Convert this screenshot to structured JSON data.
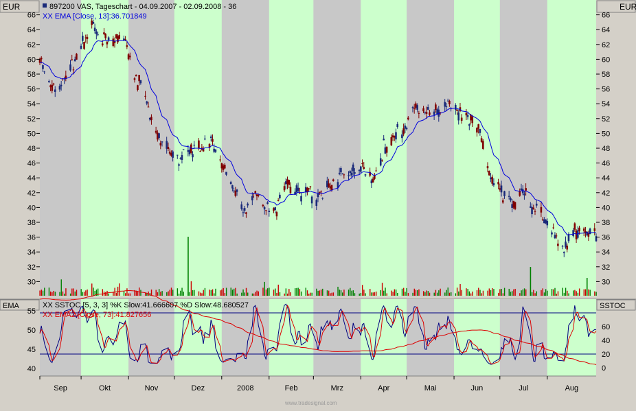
{
  "main_panel": {
    "left_unit": "EUR",
    "right_unit": "EUR",
    "legend_line1": "897200 VAS, Tageschart - 04.09.2007 - 02.09.2008 - 36",
    "legend_line2": "XX EMA [Close, 13]:36.701849"
  },
  "lower_panel": {
    "left_label": "EMA",
    "right_label": "SSTOC",
    "legend_line1": "XX SSTOC [5, 3, 3] %K Slow:41.666607 %D Slow:48.680527",
    "legend_line2": "XX EMA2 [Close, 73]:41.827656"
  },
  "footer": {
    "watermark": "www.tradesignal.com"
  },
  "colors": {
    "band_green": "#ccffcc",
    "band_gray": "#c8c8c8",
    "price_bar": "#800000",
    "price_bar_up": "#1a2a7a",
    "ema": "#0000dd",
    "volume_up": "#008000",
    "volume_down": "#cc0000",
    "k_line": "#000080",
    "d_line": "#dd0000",
    "ema2": "#dd0000",
    "stoc_levels": "#000080"
  },
  "chart_data": [
    {
      "type": "candlestick",
      "title": "897200 VAS, Tageschart - 04.09.2007 - 02.09.2008 - 36",
      "ylabel": "EUR",
      "ylim": [
        28,
        68
      ],
      "x_ticks": [
        "Sep",
        "Okt",
        "Nov",
        "Dez",
        "2008",
        "Feb",
        "Mrz",
        "Apr",
        "Mai",
        "Jun",
        "Jul",
        "Aug"
      ],
      "y_ticks": [
        30,
        32,
        34,
        36,
        38,
        40,
        42,
        44,
        46,
        48,
        50,
        52,
        54,
        56,
        58,
        60,
        62,
        64,
        66
      ],
      "close_series": [
        {
          "d": "2007-09-04",
          "c": 60
        },
        {
          "d": "2007-09-10",
          "c": 57
        },
        {
          "d": "2007-09-17",
          "c": 56
        },
        {
          "d": "2007-09-24",
          "c": 59
        },
        {
          "d": "2007-10-01",
          "c": 62
        },
        {
          "d": "2007-10-08",
          "c": 64
        },
        {
          "d": "2007-10-15",
          "c": 63
        },
        {
          "d": "2007-10-22",
          "c": 62
        },
        {
          "d": "2007-10-29",
          "c": 63
        },
        {
          "d": "2007-11-05",
          "c": 58
        },
        {
          "d": "2007-11-12",
          "c": 55
        },
        {
          "d": "2007-11-19",
          "c": 50
        },
        {
          "d": "2007-11-26",
          "c": 48
        },
        {
          "d": "2007-12-03",
          "c": 47
        },
        {
          "d": "2007-12-10",
          "c": 47
        },
        {
          "d": "2007-12-17",
          "c": 48
        },
        {
          "d": "2007-12-24",
          "c": 49
        },
        {
          "d": "2008-01-02",
          "c": 46
        },
        {
          "d": "2008-01-09",
          "c": 42
        },
        {
          "d": "2008-01-16",
          "c": 39
        },
        {
          "d": "2008-01-23",
          "c": 42
        },
        {
          "d": "2008-01-30",
          "c": 40
        },
        {
          "d": "2008-02-06",
          "c": 40
        },
        {
          "d": "2008-02-13",
          "c": 43
        },
        {
          "d": "2008-02-20",
          "c": 42
        },
        {
          "d": "2008-02-27",
          "c": 42
        },
        {
          "d": "2008-03-05",
          "c": 41
        },
        {
          "d": "2008-03-12",
          "c": 43
        },
        {
          "d": "2008-03-19",
          "c": 44
        },
        {
          "d": "2008-03-26",
          "c": 45
        },
        {
          "d": "2008-04-02",
          "c": 45
        },
        {
          "d": "2008-04-09",
          "c": 44
        },
        {
          "d": "2008-04-16",
          "c": 48
        },
        {
          "d": "2008-04-23",
          "c": 50
        },
        {
          "d": "2008-04-30",
          "c": 51
        },
        {
          "d": "2008-05-07",
          "c": 54
        },
        {
          "d": "2008-05-14",
          "c": 53
        },
        {
          "d": "2008-05-21",
          "c": 53
        },
        {
          "d": "2008-05-28",
          "c": 54
        },
        {
          "d": "2008-06-04",
          "c": 53
        },
        {
          "d": "2008-06-11",
          "c": 52
        },
        {
          "d": "2008-06-18",
          "c": 50
        },
        {
          "d": "2008-06-25",
          "c": 44
        },
        {
          "d": "2008-07-02",
          "c": 42
        },
        {
          "d": "2008-07-09",
          "c": 40
        },
        {
          "d": "2008-07-16",
          "c": 42
        },
        {
          "d": "2008-07-23",
          "c": 40
        },
        {
          "d": "2008-07-30",
          "c": 39
        },
        {
          "d": "2008-08-06",
          "c": 36
        },
        {
          "d": "2008-08-13",
          "c": 35
        },
        {
          "d": "2008-08-20",
          "c": 37
        },
        {
          "d": "2008-08-27",
          "c": 37
        },
        {
          "d": "2008-09-02",
          "c": 36.5
        }
      ],
      "ema_last": 36.701849,
      "volume_spikes": [
        {
          "d": "2007-12-10",
          "v": "highest"
        },
        {
          "d": "2008-07-21",
          "v": "high"
        },
        {
          "d": "2008-08-27",
          "v": "medium"
        }
      ]
    },
    {
      "type": "line",
      "ylabel_left": "EMA",
      "ylabel_right": "SSTOC",
      "left_ylim": [
        38,
        58
      ],
      "left_ticks": [
        40,
        45,
        50,
        55
      ],
      "right_ticks": [
        0,
        20,
        40,
        60
      ],
      "right_ylim": [
        -12,
        100
      ],
      "levels": [
        20,
        80
      ],
      "series": [
        {
          "name": "%K Slow",
          "last": 41.666607
        },
        {
          "name": "%D Slow",
          "last": 48.680527
        },
        {
          "name": "EMA2",
          "last": 41.827656
        }
      ]
    }
  ]
}
